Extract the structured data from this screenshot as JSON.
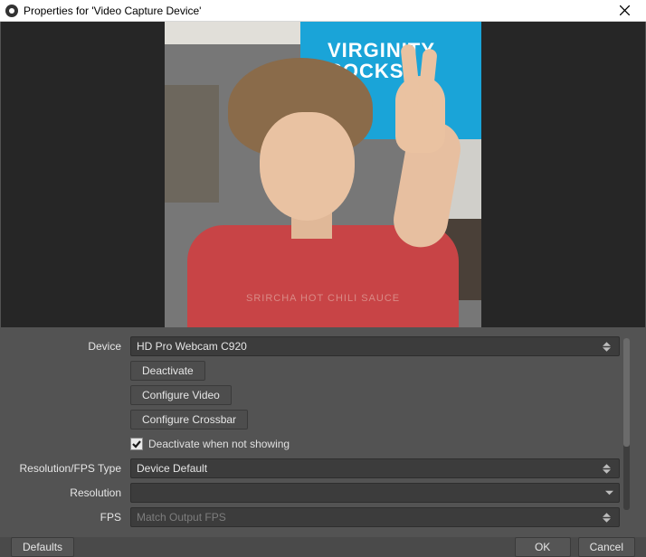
{
  "title": "Properties for 'Video Capture Device'",
  "preview_flag": {
    "line1": "VIRGINITY",
    "line2": "ROCKS"
  },
  "fields": {
    "device": {
      "label": "Device",
      "value": "HD Pro Webcam C920"
    },
    "resolution_type": {
      "label": "Resolution/FPS Type",
      "value": "Device Default"
    },
    "resolution": {
      "label": "Resolution",
      "value": ""
    },
    "fps": {
      "label": "FPS",
      "value": "",
      "placeholder": "Match Output FPS"
    }
  },
  "buttons": {
    "deactivate": "Deactivate",
    "configure_video": "Configure Video",
    "configure_crossbar": "Configure Crossbar"
  },
  "checkbox": {
    "label": "Deactivate when not showing",
    "checked": true
  },
  "footer": {
    "defaults": "Defaults",
    "ok": "OK",
    "cancel": "Cancel"
  }
}
